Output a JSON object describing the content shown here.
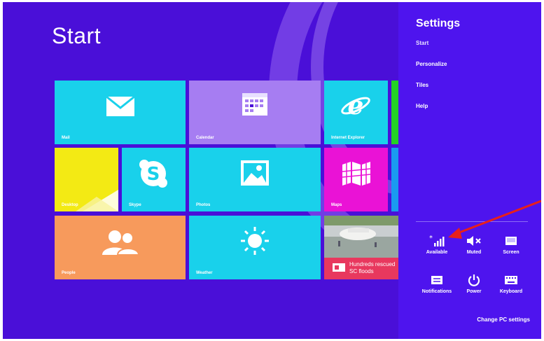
{
  "start": {
    "title": "Start"
  },
  "tiles": {
    "mail": "Mail",
    "calendar": "Calendar",
    "ie": "Internet Explorer",
    "desktop": "Desktop",
    "skype": "Skype",
    "photos": "Photos",
    "maps": "Maps",
    "people": "People",
    "weather": "Weather",
    "news": "Hundreds rescued SC floods"
  },
  "charm": {
    "title": "Settings",
    "subtitle": "Start",
    "menu": [
      "Personalize",
      "Tiles",
      "Help"
    ],
    "quick": {
      "network": "Available",
      "volume": "Muted",
      "screen": "Screen",
      "notifications": "Notifications",
      "power": "Power",
      "keyboard": "Keyboard"
    },
    "change_pc": "Change PC settings"
  },
  "colors": {
    "background": "#4a0fd8",
    "charm": "#4e14ee",
    "cyan_tile": "#19d1eb",
    "purple_tile": "#a67df2",
    "yellow_tile": "#f3ea14",
    "magenta_tile": "#ea12d6",
    "orange_tile": "#f79a5c",
    "news_tile": "#e8385e",
    "annotation_arrow": "#e8201a"
  }
}
